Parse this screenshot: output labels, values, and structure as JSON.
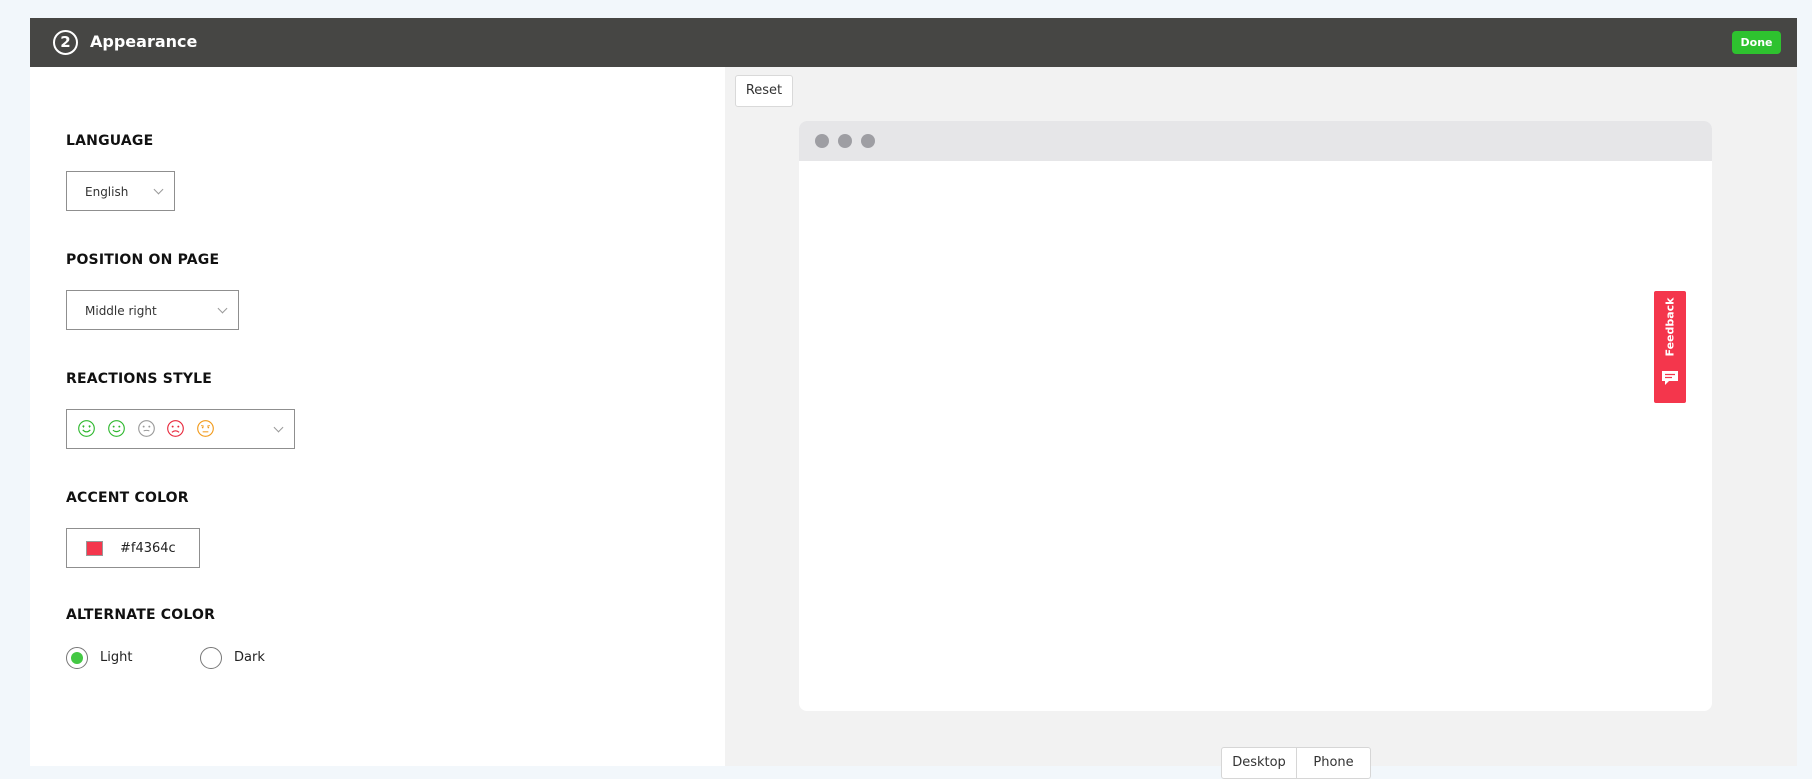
{
  "header": {
    "step_number": "2",
    "title": "Appearance",
    "done_label": "Done"
  },
  "settings": {
    "language": {
      "label": "LANGUAGE",
      "value": "English"
    },
    "position": {
      "label": "POSITION ON PAGE",
      "value": "Middle right"
    },
    "reactions": {
      "label": "REACTIONS STYLE",
      "icons": [
        {
          "name": "love-face-icon",
          "color": "#2eb82e"
        },
        {
          "name": "smile-face-icon",
          "color": "#2eb82e"
        },
        {
          "name": "neutral-face-icon",
          "color": "#9a9a9a"
        },
        {
          "name": "sad-face-icon",
          "color": "#e8283c"
        },
        {
          "name": "worried-face-icon",
          "color": "#f29a1a"
        }
      ]
    },
    "accent": {
      "label": "ACCENT COLOR",
      "value": "#f4364c",
      "swatch": "#f4364c"
    },
    "alternate": {
      "label": "ALTERNATE COLOR",
      "options": [
        {
          "label": "Light",
          "selected": true
        },
        {
          "label": "Dark",
          "selected": false
        }
      ]
    }
  },
  "preview": {
    "reset_label": "Reset",
    "feedback_label": "Feedback",
    "view_modes": [
      "Desktop",
      "Phone"
    ]
  },
  "colors": {
    "header_bg": "#464644",
    "done_bg": "#2ec22f",
    "accent": "#f4364c",
    "radio_selected": "#43c843"
  }
}
